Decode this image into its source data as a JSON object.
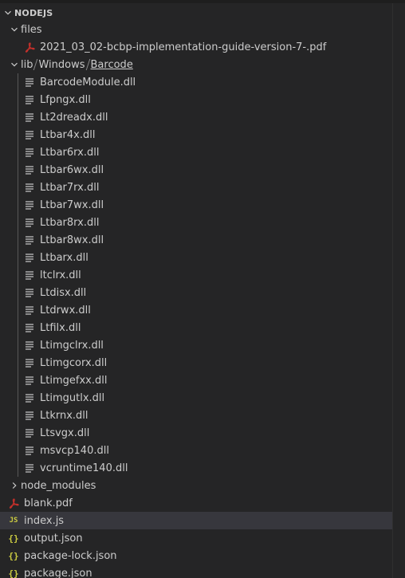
{
  "explorer": {
    "section_title": "NODEJS",
    "colors": {
      "background": "#252526",
      "selected_row": "#37373d",
      "text": "#cccccc",
      "pdf_icon": "#c5302b",
      "json_icon": "#cbcb41",
      "js_icon": "#cbcb41"
    },
    "tree": {
      "files_folder": {
        "label": "files",
        "icon": "chevron-down-icon",
        "children": [
          "2021_03_02-bcbp-implementation-guide-version-7-.pdf"
        ]
      },
      "lib_path": {
        "segments": [
          "lib",
          "Windows",
          "Barcode"
        ],
        "icon": "chevron-down-icon",
        "children": [
          "BarcodeModule.dll",
          "Lfpngx.dll",
          "Lt2dreadx.dll",
          "Ltbar4x.dll",
          "Ltbar6rx.dll",
          "Ltbar6wx.dll",
          "Ltbar7rx.dll",
          "Ltbar7wx.dll",
          "Ltbar8rx.dll",
          "Ltbar8wx.dll",
          "Ltbarx.dll",
          "ltclrx.dll",
          "Ltdisx.dll",
          "Ltdrwx.dll",
          "Ltfilx.dll",
          "Ltimgclrx.dll",
          "Ltimgcorx.dll",
          "Ltimgefxx.dll",
          "Ltimgutlx.dll",
          "Ltkrnx.dll",
          "Ltsvgx.dll",
          "msvcp140.dll",
          "vcruntime140.dll"
        ]
      },
      "node_modules": {
        "label": "node_modules",
        "icon": "chevron-right-icon"
      },
      "root_files": [
        {
          "label": "blank.pdf",
          "icon": "pdf-file-icon"
        },
        {
          "label": "index.js",
          "icon": "js-file-icon",
          "selected": true
        },
        {
          "label": "output.json",
          "icon": "json-file-icon"
        },
        {
          "label": "package-lock.json",
          "icon": "json-file-icon"
        },
        {
          "label": "package.json",
          "icon": "json-file-icon"
        }
      ]
    }
  }
}
